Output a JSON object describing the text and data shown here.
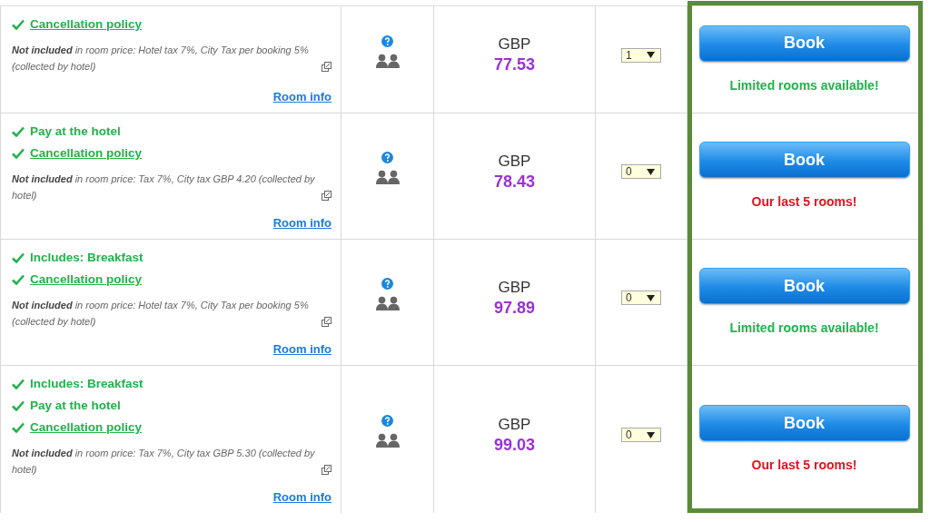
{
  "rooms": [
    {
      "features": [
        {
          "kind": "link",
          "text": "Cancellation policy"
        }
      ],
      "tax_note": "**Not included** in room price: Hotel tax 7%, City Tax per booking 5% (collected by hotel)",
      "room_info": "Room info",
      "currency": "GBP",
      "price": "77.53",
      "quantity": "1",
      "book": "Book",
      "notice": {
        "text": "Limited rooms available!",
        "color": "#22b24c"
      }
    },
    {
      "features": [
        {
          "kind": "plain",
          "text": "Pay at the hotel"
        },
        {
          "kind": "link",
          "text": "Cancellation policy"
        }
      ],
      "tax_note": "**Not included** in room price: Tax 7%, City tax GBP 4.20 (collected by hotel)",
      "room_info": "Room info",
      "currency": "GBP",
      "price": "78.43",
      "quantity": "0",
      "book": "Book",
      "notice": {
        "text": "Our last 5 rooms!",
        "color": "#e0141e"
      }
    },
    {
      "features": [
        {
          "kind": "plain",
          "text": "Includes: Breakfast"
        },
        {
          "kind": "link",
          "text": "Cancellation policy"
        }
      ],
      "tax_note": "**Not included** in room price: Hotel tax 7%, City Tax per booking 5% (collected by hotel)",
      "room_info": "Room info",
      "currency": "GBP",
      "price": "97.89",
      "quantity": "0",
      "book": "Book",
      "notice": {
        "text": "Limited rooms available!",
        "color": "#22b24c"
      }
    },
    {
      "features": [
        {
          "kind": "plain",
          "text": "Includes: Breakfast"
        },
        {
          "kind": "plain",
          "text": "Pay at the hotel"
        },
        {
          "kind": "link",
          "text": "Cancellation policy"
        }
      ],
      "tax_note": "**Not included** in room price: Tax 7%, City tax GBP 5.30 (collected by hotel)",
      "room_info": "Room info",
      "currency": "GBP",
      "price": "99.03",
      "quantity": "0",
      "book": "Book",
      "notice": {
        "text": "Our last 5 rooms!",
        "color": "#e0141e"
      }
    }
  ]
}
